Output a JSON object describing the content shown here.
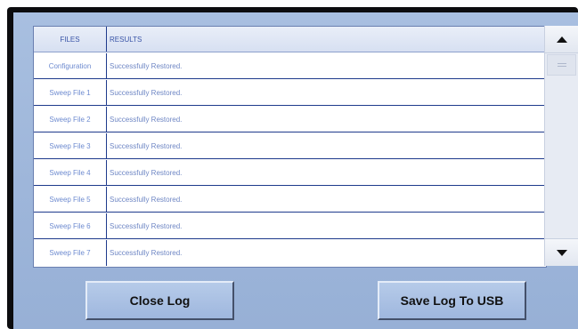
{
  "log_table": {
    "headers": {
      "files": "FILES",
      "results": "RESULTS"
    },
    "rows": [
      {
        "file": "Configuration",
        "result": "Successfully Restored."
      },
      {
        "file": "Sweep File 1",
        "result": "Successfully Restored."
      },
      {
        "file": "Sweep File 2",
        "result": "Successfully Restored."
      },
      {
        "file": "Sweep File 3",
        "result": "Successfully Restored."
      },
      {
        "file": "Sweep File 4",
        "result": "Successfully Restored."
      },
      {
        "file": "Sweep File 5",
        "result": "Successfully Restored."
      },
      {
        "file": "Sweep File 6",
        "result": "Successfully Restored."
      },
      {
        "file": "Sweep File 7",
        "result": "Successfully Restored."
      }
    ]
  },
  "scrollbar": {
    "up_icon": "triangle-up-icon",
    "down_icon": "triangle-down-icon"
  },
  "buttons": {
    "close_label": "Close Log",
    "save_label": "Save Log To USB"
  },
  "colors": {
    "screen_background": "#a8bfe0",
    "table_line": "#1e3a8c",
    "table_text": "#6e86c4"
  }
}
